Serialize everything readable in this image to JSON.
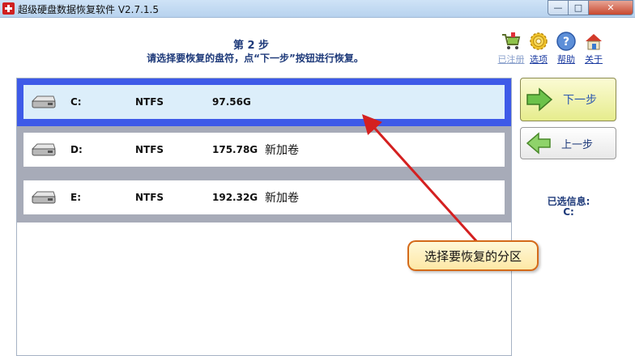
{
  "window": {
    "title": "超级硬盘数据恢复软件 V2.7.1.5",
    "controls": {
      "minimize": "—",
      "maximize": "□",
      "close": "✕"
    }
  },
  "header": {
    "step": "第 2 步",
    "instruction": "请选择要恢复的盘符，点“下一步”按钮进行恢复。"
  },
  "toolbar": {
    "items": [
      {
        "label": "已注册",
        "icon": "cart-icon",
        "enabled": false
      },
      {
        "label": "选项",
        "icon": "gear-icon",
        "enabled": true
      },
      {
        "label": "帮助",
        "icon": "help-icon",
        "enabled": true
      },
      {
        "label": "关于",
        "icon": "home-icon",
        "enabled": true
      }
    ]
  },
  "partitions": [
    {
      "letter": "C:",
      "fs": "NTFS",
      "size": "97.56G",
      "label": "",
      "selected": true
    },
    {
      "letter": "D:",
      "fs": "NTFS",
      "size": "175.78G",
      "label": "新加卷",
      "selected": false
    },
    {
      "letter": "E:",
      "fs": "NTFS",
      "size": "192.32G",
      "label": "新加卷",
      "selected": false
    }
  ],
  "buttons": {
    "next": "下一步",
    "prev": "上一步"
  },
  "info": {
    "title": "已选信息:",
    "value": "C:"
  },
  "annotation": {
    "text": "选择要恢复的分区"
  },
  "colors": {
    "selected_border": "#3e5ae8",
    "row_border": "#a7abb8",
    "selected_fill": "#dceefa",
    "heading_blue": "#1e3a7a",
    "arrow_red": "#d42020",
    "next_button": "#e6ec8d"
  }
}
